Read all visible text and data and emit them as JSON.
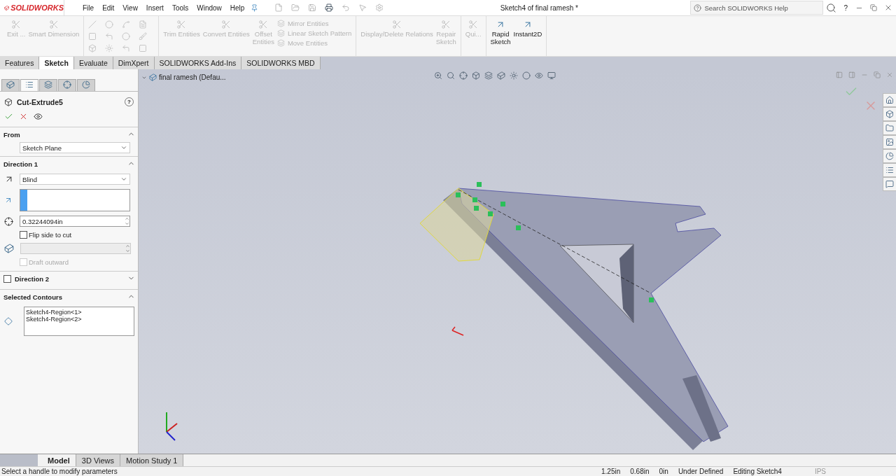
{
  "app_bar": {
    "logo": "SOLIDWORKS",
    "menus": [
      "File",
      "Edit",
      "View",
      "Insert",
      "Tools",
      "Window",
      "Help"
    ],
    "title": "Sketch4 of final ramesh *",
    "search": {
      "placeholder": "Search SOLIDWORKS Help"
    },
    "help": "?"
  },
  "ribbon": {
    "sections": [
      [
        {
          "kind": "wide",
          "items": [
            {
              "label": "Exit ...",
              "disabled": true
            },
            {
              "label": "Smart Dimension",
              "disabled": true
            }
          ]
        }
      ],
      [
        {
          "kind": "tools"
        }
      ],
      [
        {
          "kind": "wide",
          "items": [
            {
              "label": "Trim Entities",
              "disabled": true
            },
            {
              "label": "Convert Entities",
              "disabled": true
            }
          ]
        },
        {
          "kind": "narrow",
          "items": [
            {
              "label": "Offset Entities",
              "disabled": true
            }
          ]
        },
        {
          "kind": "stack",
          "items": [
            {
              "label": "Mirror Entities",
              "disabled": true
            },
            {
              "label": "Linear Sketch Pattern",
              "disabled": true
            },
            {
              "label": "Move Entities",
              "disabled": true
            }
          ]
        }
      ],
      [
        {
          "kind": "wide",
          "items": [
            {
              "label": "Display/Delete Relations",
              "disabled": true
            }
          ]
        },
        {
          "kind": "narrow",
          "items": [
            {
              "label": "Repair Sketch",
              "disabled": true
            }
          ]
        }
      ],
      [
        {
          "kind": "narrow",
          "items": [
            {
              "label": "Qui...",
              "disabled": true
            }
          ]
        }
      ],
      [
        {
          "kind": "narrow",
          "items": [
            {
              "label": "Rapid Sketch",
              "disabled": false
            }
          ]
        },
        {
          "kind": "wide",
          "items": [
            {
              "label": "Instant2D",
              "disabled": false
            }
          ]
        }
      ]
    ]
  },
  "command_tabs": [
    {
      "label": "Features",
      "selected": false
    },
    {
      "label": "Sketch",
      "selected": true
    },
    {
      "label": "Evaluate",
      "selected": false
    },
    {
      "label": "DimXpert",
      "selected": false
    },
    {
      "label": "SOLIDWORKS Add-Ins",
      "selected": false
    },
    {
      "label": "SOLIDWORKS MBD",
      "selected": false
    }
  ],
  "panel_tabs": [
    {
      "selected": false
    },
    {
      "selected": true
    },
    {
      "selected": false
    },
    {
      "selected": false
    },
    {
      "selected": false
    }
  ],
  "property_manager": {
    "title": "Cut-Extrude5",
    "help": "?",
    "from": {
      "label": "From",
      "expanded": true,
      "value": "Sketch Plane"
    },
    "direction1": {
      "label": "Direction 1",
      "expanded": true,
      "end_condition": "Blind",
      "depth": "0.32244094in",
      "flip": {
        "label": "Flip side to cut",
        "checked": false
      },
      "draft": {
        "label": "Draft outward",
        "checked": false,
        "disabled": true
      }
    },
    "direction2": {
      "label": "Direction 2",
      "checked": false,
      "expanded": false
    },
    "contours": {
      "label": "Selected Contours",
      "expanded": true,
      "items": [
        "Sketch4-Region<1>",
        "Sketch4-Region<2>"
      ]
    }
  },
  "tree": {
    "label": "final ramesh  (Defau..."
  },
  "bottom_tabs": [
    {
      "label": "Model",
      "selected": true
    },
    {
      "label": "3D Views",
      "selected": false
    },
    {
      "label": "Motion Study 1",
      "selected": false
    }
  ],
  "status_bar": {
    "message": "Select a handle to modify parameters",
    "fields": [
      "1.25in",
      "0.68in",
      "0in",
      "Under Defined",
      "Editing Sketch4",
      "IPS"
    ]
  }
}
